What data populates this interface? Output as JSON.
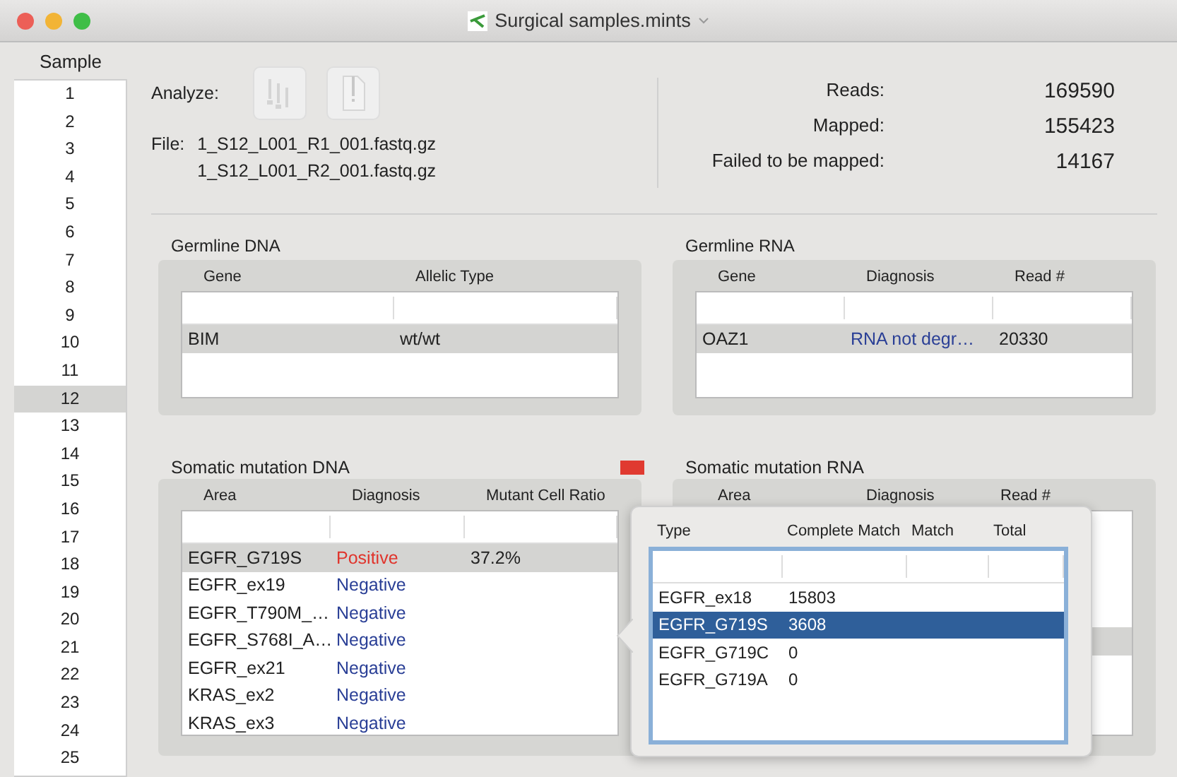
{
  "window": {
    "title": "Surgical samples.mints"
  },
  "sidebar": {
    "header": "Sample",
    "items": [
      {
        "label": "1",
        "selected": false
      },
      {
        "label": "2",
        "selected": false
      },
      {
        "label": "3",
        "selected": false
      },
      {
        "label": "4",
        "selected": false
      },
      {
        "label": "5",
        "selected": false
      },
      {
        "label": "6",
        "selected": false
      },
      {
        "label": "7",
        "selected": false
      },
      {
        "label": "8",
        "selected": false
      },
      {
        "label": "9",
        "selected": false
      },
      {
        "label": "10",
        "selected": false
      },
      {
        "label": "11",
        "selected": false
      },
      {
        "label": "12",
        "selected": true
      },
      {
        "label": "13",
        "selected": false
      },
      {
        "label": "14",
        "selected": false
      },
      {
        "label": "15",
        "selected": false
      },
      {
        "label": "16",
        "selected": false
      },
      {
        "label": "17",
        "selected": false
      },
      {
        "label": "18",
        "selected": false
      },
      {
        "label": "19",
        "selected": false
      },
      {
        "label": "20",
        "selected": false
      },
      {
        "label": "21",
        "selected": false
      },
      {
        "label": "22",
        "selected": false
      },
      {
        "label": "23",
        "selected": false
      },
      {
        "label": "24",
        "selected": false
      },
      {
        "label": "25",
        "selected": false
      }
    ]
  },
  "analyze": {
    "label": "Analyze:"
  },
  "file": {
    "label": "File:",
    "names": [
      "1_S12_L001_R1_001.fastq.gz",
      "1_S12_L001_R2_001.fastq.gz"
    ]
  },
  "stats": [
    {
      "label": "Reads:",
      "value": "169590"
    },
    {
      "label": "Mapped:",
      "value": "155423"
    },
    {
      "label": "Failed to be mapped:",
      "value": "14167"
    }
  ],
  "germline_dna": {
    "title": "Germline DNA",
    "columns": [
      "Gene",
      "Allelic Type"
    ],
    "rows": [
      {
        "cells": [
          "BIM",
          "wt/wt"
        ],
        "positive": false,
        "selected": true
      }
    ]
  },
  "germline_rna": {
    "title": "Germline RNA",
    "columns": [
      "Gene",
      "Diagnosis",
      "Read #"
    ],
    "rows": [
      {
        "cells": [
          "OAZ1",
          "RNA not degr…",
          "20330"
        ],
        "positive": false,
        "selected": true
      }
    ]
  },
  "somatic_dna": {
    "title": "Somatic mutation DNA",
    "flagged": true,
    "columns": [
      "Area",
      "Diagnosis",
      "Mutant Cell Ratio"
    ],
    "rows": [
      {
        "cells": [
          "EGFR_G719S",
          "Positive",
          "37.2%"
        ],
        "positive": true,
        "selected": true
      },
      {
        "cells": [
          "EGFR_ex19",
          "Negative"
        ],
        "positive": false,
        "selected": false
      },
      {
        "cells": [
          "EGFR_T790M_…",
          "Negative"
        ],
        "positive": false,
        "selected": false
      },
      {
        "cells": [
          "EGFR_S768I_A…",
          "Negative"
        ],
        "positive": false,
        "selected": false
      },
      {
        "cells": [
          "EGFR_ex21",
          "Negative"
        ],
        "positive": false,
        "selected": false
      },
      {
        "cells": [
          "KRAS_ex2",
          "Negative"
        ],
        "positive": false,
        "selected": false
      },
      {
        "cells": [
          "KRAS_ex3",
          "Negative"
        ],
        "positive": false,
        "selected": false
      }
    ]
  },
  "somatic_rna": {
    "title": "Somatic mutation RNA",
    "columns": [
      "Area",
      "Diagnosis",
      "Read #"
    ]
  },
  "popover": {
    "columns": [
      "Type",
      "Complete Match",
      "Match",
      "Total"
    ],
    "rows": [
      {
        "cells": [
          "EGFR_ex18",
          "15803"
        ],
        "selected": false
      },
      {
        "cells": [
          "EGFR_G719S",
          "3608"
        ],
        "selected": true
      },
      {
        "cells": [
          "EGFR_G719C",
          "0"
        ],
        "selected": false
      },
      {
        "cells": [
          "EGFR_G719A",
          "0"
        ],
        "selected": false
      }
    ]
  }
}
